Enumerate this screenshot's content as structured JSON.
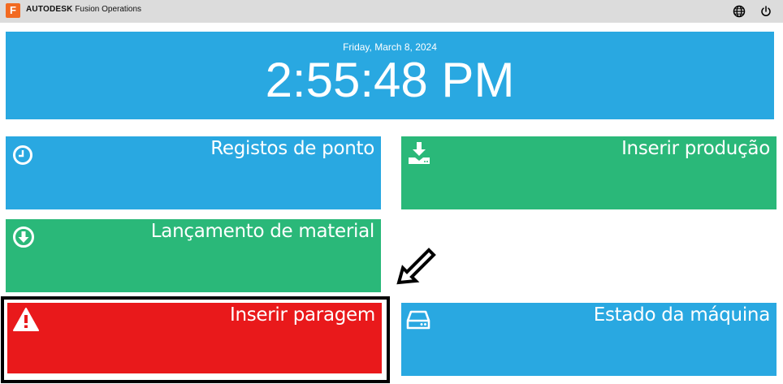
{
  "app": {
    "brand_bold": "AUTODESK",
    "brand_name": "Fusion Operations",
    "logo_letter": "F"
  },
  "header": {
    "language_icon": "globe-icon",
    "power_icon": "power-icon"
  },
  "clock": {
    "date": "Friday, March 8, 2024",
    "time": "2:55:48 PM"
  },
  "tiles": [
    {
      "label": "Registos de ponto",
      "icon": "clock-icon",
      "color": "#29a8e1"
    },
    {
      "label": "Inserir produção",
      "icon": "download-tray-icon",
      "color": "#2ab879"
    },
    {
      "label": "Lançamento de material",
      "icon": "arrow-down-circle-icon",
      "color": "#2ab879"
    },
    {
      "label": "Inserir paragem",
      "icon": "warning-icon",
      "color": "#e9191b"
    },
    {
      "label": "Estado da máquina",
      "icon": "hard-drive-icon",
      "color": "#29a8e1"
    }
  ],
  "colors": {
    "topbar": "#dcdcdc",
    "blue": "#29a8e1",
    "green": "#2ab879",
    "red": "#e9191b",
    "logo": "#f26a21"
  }
}
